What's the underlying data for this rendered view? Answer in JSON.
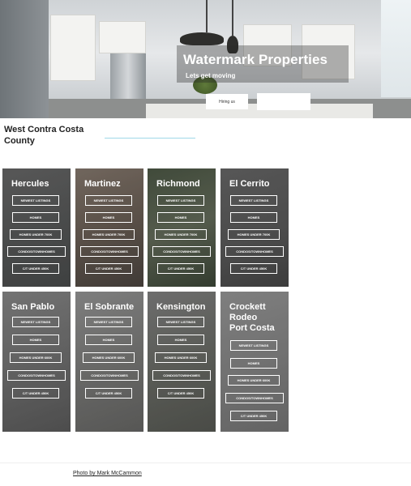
{
  "hero": {
    "title": "Watermark Properties",
    "subtitle": "Lets get moving",
    "button1_label": "Hiring us",
    "button2_label": ""
  },
  "section": {
    "title": "West Contra Costa County"
  },
  "cards": [
    {
      "name": "Hercules",
      "buttons": [
        "NEWEST LISTINGS",
        "HOMES",
        "HOMES UNDER 700K",
        "CONDOS/TOWNHOMES",
        "C/T UNDER 450K"
      ]
    },
    {
      "name": "Martinez",
      "buttons": [
        "NEWEST LISTINGS",
        "HOMES",
        "HOMES UNDER 700K",
        "CONDOS/TOWNHOMES",
        "C/T UNDER 450K"
      ]
    },
    {
      "name": "Richmond",
      "buttons": [
        "NEWEST LISTINGS",
        "HOMES",
        "HOMES UNDER 700K",
        "CONDOS/TOWNHOMES",
        "C/T UNDER 450K"
      ]
    },
    {
      "name": "El Cerrito",
      "buttons": [
        "NEWEST LISTINGS",
        "HOMES",
        "HOMES UNDER 700K",
        "CONDOS/TOWNHOMES",
        "C/T UNDER 450K"
      ]
    },
    {
      "name": "San Pablo",
      "buttons": [
        "NEWEST LISTINGS",
        "HOMES",
        "HOMES UNDER 600K",
        "CONDOS/TOWNHOMES",
        "C/T UNDER 450K"
      ]
    },
    {
      "name": "El Sobrante",
      "buttons": [
        "NEWEST LISTINGS",
        "HOMES",
        "HOMES UNDER 600K",
        "CONDOS/TOWNHOMES",
        "C/T UNDER 450K"
      ]
    },
    {
      "name": "Kensington",
      "buttons": [
        "NEWEST LISTINGS",
        "HOMES",
        "HOMES UNDER 600K",
        "CONDOS/TOWNHOMES",
        "C/T UNDER 450K"
      ]
    },
    {
      "name": "Crockett\nRodeo\nPort Costa",
      "buttons": [
        "NEWEST LISTINGS",
        "HOMES",
        "HOMES UNDER 600K",
        "CONDOS/TOWNHOMES",
        "C/T UNDER 450K"
      ]
    }
  ],
  "footer": {
    "credit": "Photo by Mark McCammon"
  },
  "colors": {
    "accent_line": "#9fd8e8",
    "card_grey": "#7b7b7b"
  }
}
